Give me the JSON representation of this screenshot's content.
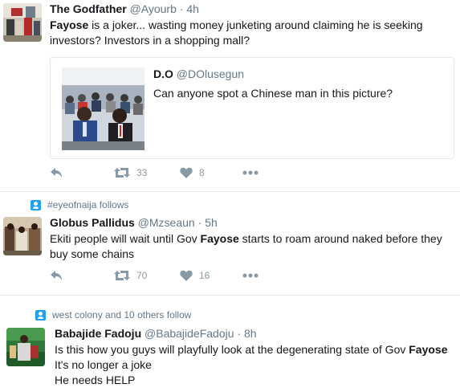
{
  "tweets": [
    {
      "name": "The Godfather",
      "handle": "@Ayourb",
      "dot": "·",
      "time": "4h",
      "text_parts": [
        "Fayose",
        " is a joker... wasting money junketing around claiming he is seeking investors? Investors in a shopping mall?"
      ],
      "quote": {
        "name": "D.O",
        "handle": "@DOlusegun",
        "text": "Can anyone spot a Chinese man in this picture?"
      },
      "retweets": "33",
      "likes": "8"
    },
    {
      "context": "#eyeofnaija follows",
      "name": "Globus Pallidus",
      "handle": "@Mzseaun",
      "dot": "·",
      "time": "5h",
      "text_parts": [
        "Ekiti people will wait until Gov ",
        "Fayose",
        " starts to roam around naked before they buy some chains"
      ],
      "retweets": "70",
      "likes": "16"
    },
    {
      "context": "west colony and 10 others follow",
      "name": "Babajide Fadoju",
      "handle": "@BabajideFadoju",
      "dot": "·",
      "time": "8h",
      "text_parts": [
        "Is this how you guys will playfully look at the degenerating state of Gov ",
        "Fayose"
      ],
      "text_line2": "It's no longer a joke",
      "text_line3": "He needs HELP"
    }
  ],
  "icons": {
    "reply": "reply-icon",
    "retweet": "retweet-icon",
    "like": "heart-icon",
    "more": "more-icon",
    "follows": "person-icon"
  },
  "colors": {
    "text": "#14171a",
    "muted": "#657786",
    "icon": "#8899a6",
    "border": "#e1e8ed",
    "accent": "#1da1f2"
  }
}
